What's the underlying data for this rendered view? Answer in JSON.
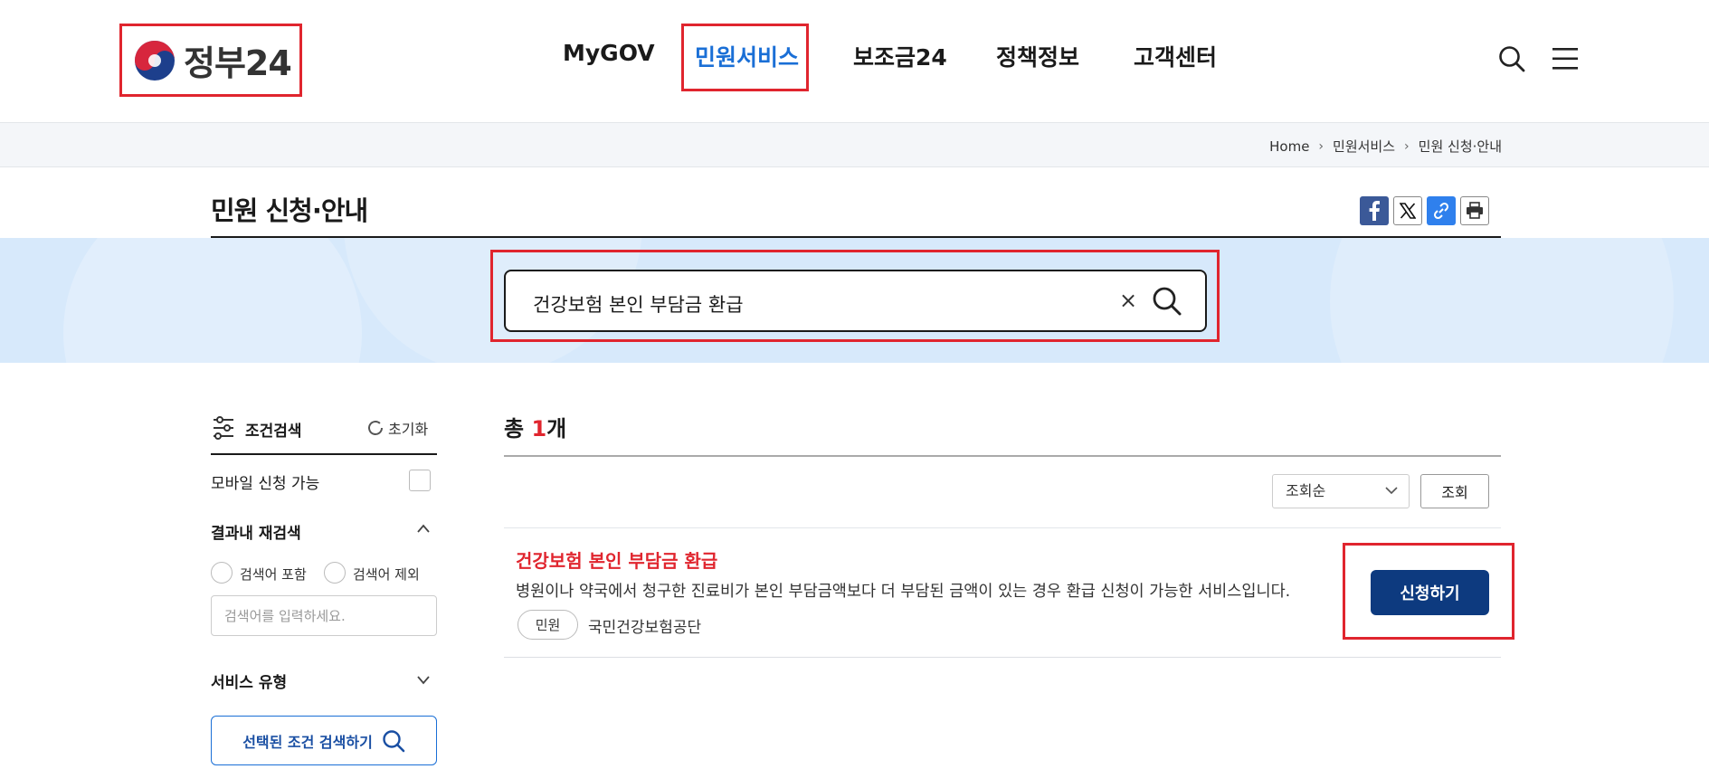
{
  "header": {
    "logo_text": "정부24",
    "nav": [
      "MyGOV",
      "민원서비스",
      "보조금24",
      "정책정보",
      "고객센터"
    ],
    "active_nav": "민원서비스"
  },
  "breadcrumb": [
    "Home",
    "민원서비스",
    "민원 신청·안내"
  ],
  "page_title": "민원 신청·안내",
  "share_icons": [
    "facebook-icon",
    "x-icon",
    "link-icon",
    "print-icon"
  ],
  "search": {
    "query": "건강보험 본인 부담금 환급",
    "clear_symbol": "×"
  },
  "sidebar": {
    "title": "조건검색",
    "reset_label": "초기화",
    "mobile_label": "모바일 신청 가능",
    "refine_label": "결과내 재검색",
    "include_label": "검색어 포함",
    "exclude_label": "검색어 제외",
    "refine_placeholder": "검색어를 입력하세요.",
    "service_type_label": "서비스 유형",
    "search_button": "선택된 조건 검색하기"
  },
  "results": {
    "total_prefix": "총 ",
    "total_count": "1",
    "total_suffix": "개",
    "sort_selected": "조회순",
    "view_button": "조회",
    "items": [
      {
        "title": "건강보험 본인 부담금 환급",
        "description": "병원이나 약국에서 청구한 진료비가 본인 부담금액보다 더 부담된 금액이 있는 경우 환급 신청이 가능한 서비스입니다.",
        "tag": "민원",
        "organization": "국민건강보험공단",
        "apply_label": "신청하기"
      }
    ]
  },
  "colors": {
    "accent_blue": "#1a6fd6",
    "highlight_red": "#e0252e",
    "navy_button": "#0d3a7f",
    "search_band": "#d7e9fb"
  }
}
